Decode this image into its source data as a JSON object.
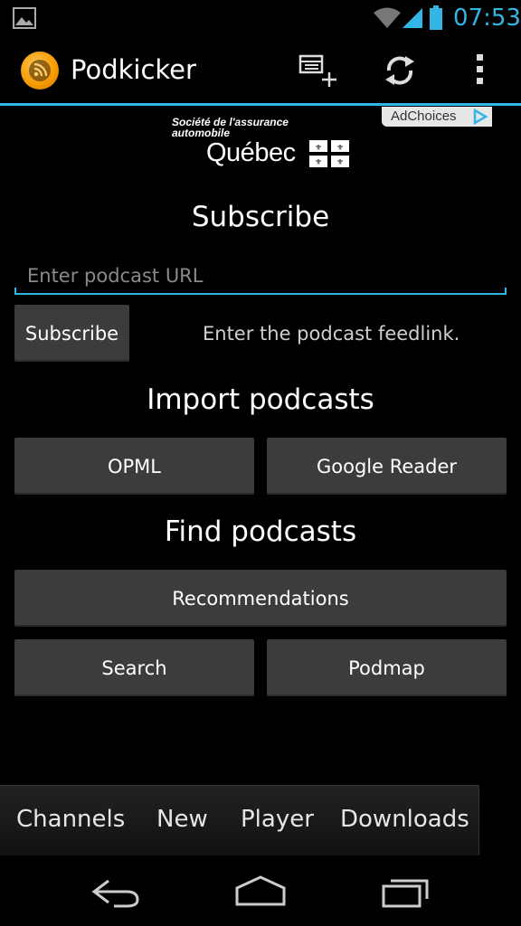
{
  "status_bar": {
    "time": "07:53",
    "icons": [
      "image-notification-icon",
      "wifi-icon",
      "signal-icon",
      "battery-icon"
    ],
    "accent_color": "#33b5e5"
  },
  "action_bar": {
    "title": "Podkicker",
    "actions": [
      "add-subscription-icon",
      "refresh-icon",
      "overflow-menu-icon"
    ],
    "accent_color": "#33b5e5"
  },
  "ad": {
    "line1": "Société de l'assurance",
    "line2": "automobile",
    "brand": "Québec",
    "adchoices_label": "AdChoices"
  },
  "subscribe": {
    "heading": "Subscribe",
    "url_placeholder": "Enter podcast URL",
    "url_value": "",
    "button_label": "Subscribe",
    "hint": "Enter the podcast feedlink."
  },
  "import": {
    "heading": "Import podcasts",
    "buttons": [
      "OPML",
      "Google Reader"
    ]
  },
  "find": {
    "heading": "Find podcasts",
    "recommendations_label": "Recommendations",
    "search_label": "Search",
    "podmap_label": "Podmap"
  },
  "tabs": [
    "Channels",
    "New",
    "Player",
    "Downloads"
  ],
  "nav": [
    "back-icon",
    "home-icon",
    "recents-icon"
  ]
}
